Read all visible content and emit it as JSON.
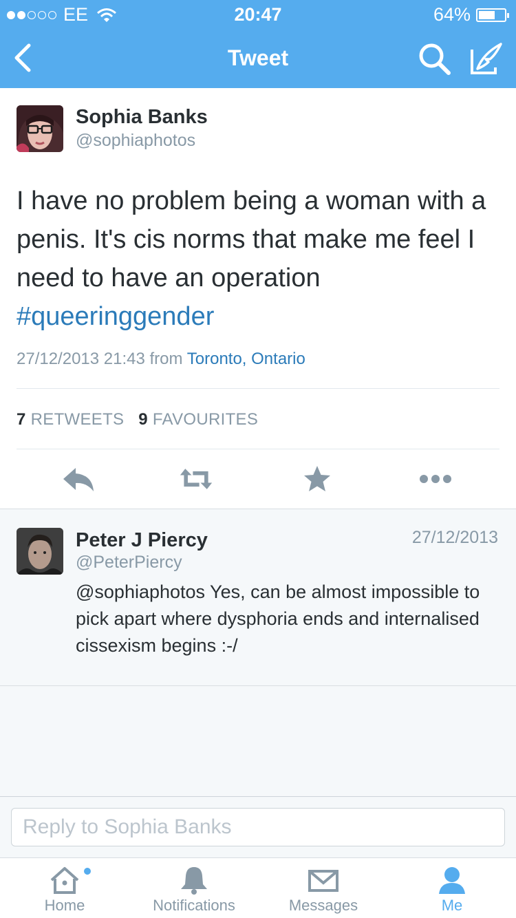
{
  "status_bar": {
    "carrier": "EE",
    "time": "20:47",
    "battery": "64%",
    "battery_level": 0.64
  },
  "nav": {
    "title": "Tweet",
    "back_icon": "chevron-left-icon",
    "search_icon": "search-icon",
    "compose_icon": "compose-icon"
  },
  "tweet": {
    "author_name": "Sophia Banks",
    "author_handle": "@sophiaphotos",
    "text": "I have no problem being a woman with a penis. It's cis norms that make me feel I need to have an operation",
    "hashtag": "#queeringgender",
    "timestamp": "27/12/2013 21:43",
    "from_label": "from",
    "location": "Toronto, Ontario",
    "retweets_count": "7",
    "retweets_label": "RETWEETS",
    "favourites_count": "9",
    "favourites_label": "FAVOURITES",
    "actions": [
      "reply-icon",
      "retweet-icon",
      "star-icon",
      "more-icon"
    ]
  },
  "reply": {
    "author_name": "Peter J Piercy",
    "author_handle": "@PeterPiercy",
    "date": "27/12/2013",
    "text": "@sophiaphotos Yes, can be almost impossible to pick apart where dysphoria ends and internalised cissexism begins :-/"
  },
  "composer": {
    "placeholder": "Reply to Sophia Banks"
  },
  "tabs": [
    {
      "label": "Home",
      "icon": "home-icon",
      "active": false
    },
    {
      "label": "Notifications",
      "icon": "bell-icon",
      "active": false
    },
    {
      "label": "Messages",
      "icon": "envelope-icon",
      "active": false
    },
    {
      "label": "Me",
      "icon": "person-icon",
      "active": true
    }
  ],
  "colors": {
    "brand": "#55acee",
    "link": "#2b7bb9",
    "muted": "#8899a6",
    "text": "#292f33"
  }
}
